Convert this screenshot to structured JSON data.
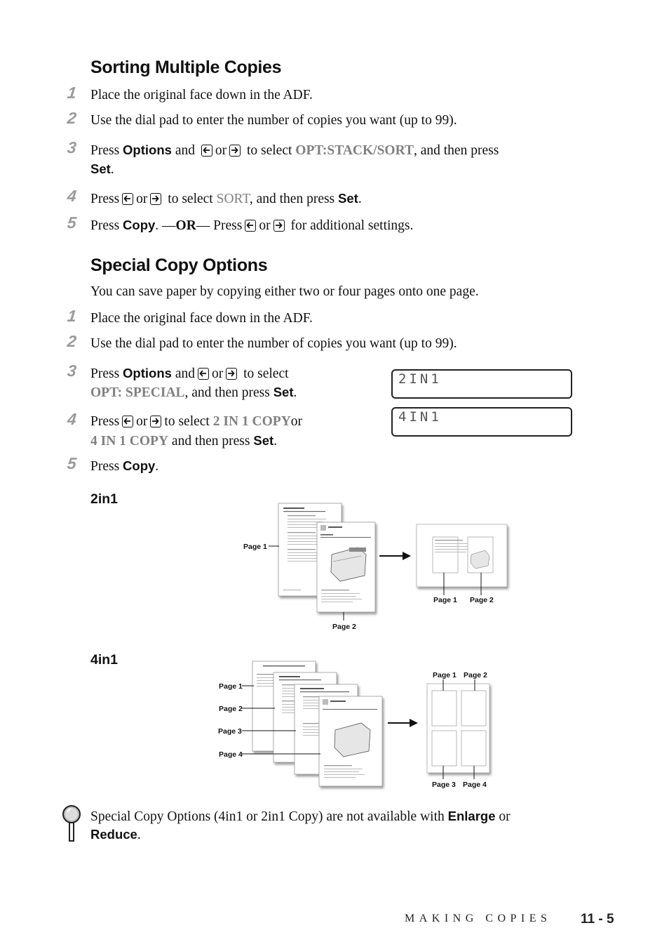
{
  "sections": {
    "sorting": {
      "title": "Sorting Multiple Copies",
      "steps": [
        {
          "num": "1",
          "text": "Place the original face down in the ADF."
        },
        {
          "num": "2",
          "text": "Use the dial pad to enter the number of copies you want (up to 99)."
        },
        {
          "num": "3",
          "press": "Press",
          "options": "Options",
          "and": "and",
          "or": "or",
          "to_select": "to select",
          "value": "OPT:STACK/SORT",
          "then": ", and then press",
          "set": "Set",
          "end": "."
        },
        {
          "num": "4",
          "press": "Press",
          "or": "or",
          "to_select": "to select",
          "value": "SORT",
          "then": ", and then press",
          "set": "Set",
          "end": "."
        },
        {
          "num": "5",
          "press": "Press",
          "copy": "Copy",
          "dot": ". —",
          "or_word": "OR",
          "dash_press": "— Press",
          "or": "or",
          "rest": "for additional settings."
        }
      ]
    },
    "special": {
      "title": "Special Copy Options",
      "intro": "You can save paper by copying either two or four pages onto one page.",
      "steps": [
        {
          "num": "1",
          "text": "Place the original face down in the ADF."
        },
        {
          "num": "2",
          "text": "Use the dial pad to enter the number of copies you want (up to 99)."
        },
        {
          "num": "3",
          "press": "Press",
          "options": "Options",
          "and": "and",
          "or": "or",
          "to_select": "to select",
          "value": "OPT: SPECIAL",
          "then": ", and then press",
          "set": "Set",
          "end": "."
        },
        {
          "num": "4",
          "press": "Press",
          "or": "or",
          "to_select": "to select",
          "value1": "2 IN 1 COPY",
          "or2": "or",
          "value2": "4 IN 1 COPY",
          "then": "and then press",
          "set": "Set",
          "end": "."
        },
        {
          "num": "5",
          "press": "Press",
          "copy": "Copy",
          "end": "."
        }
      ],
      "lcd": [
        "2IN1",
        "4IN1"
      ]
    }
  },
  "icons": {
    "left_key": "left-arrow-key-icon",
    "right_key": "right-arrow-key-icon",
    "note": "magnifier-note-icon"
  },
  "figures": {
    "twoin1": {
      "label": "2in1",
      "page_labels": [
        "Page 1",
        "Page 2"
      ],
      "result_labels": [
        "Page 1",
        "Page 2"
      ]
    },
    "fourin1": {
      "label": "4in1",
      "page_labels": [
        "Page 1",
        "Page 2",
        "Page 3",
        "Page 4"
      ],
      "result_labels": [
        "Page 1",
        "Page 2",
        "Page 3",
        "Page 4"
      ]
    }
  },
  "note": {
    "text": "Special Copy Options (4in1 or 2in1 Copy) are not available with",
    "enlarge": "Enlarge",
    "or": "or",
    "reduce": "Reduce",
    "end": "."
  },
  "footer": {
    "chapter": "MAKING COPIES",
    "page": "11 - 5"
  }
}
